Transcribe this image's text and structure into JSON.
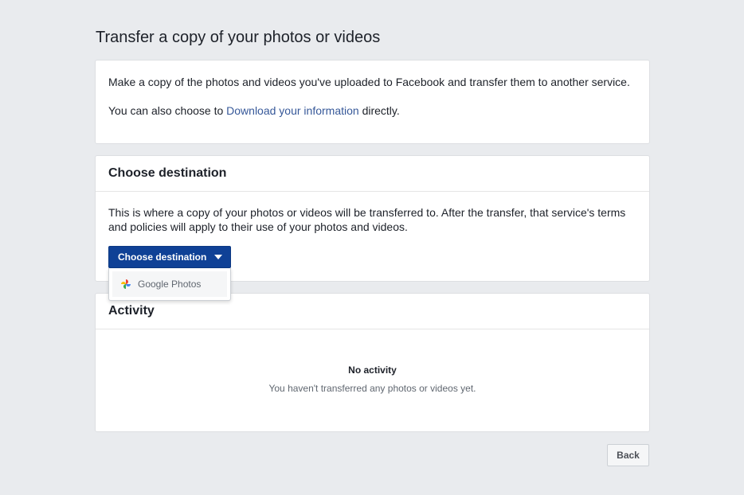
{
  "page": {
    "title": "Transfer a copy of your photos or videos"
  },
  "intro": {
    "line1": "Make a copy of the photos and videos you've uploaded to Facebook and transfer them to another service.",
    "line2_prefix": "You can also choose to ",
    "line2_link": "Download your information",
    "line2_suffix": " directly."
  },
  "destination": {
    "header": "Choose destination",
    "description": "This is where a copy of your photos or videos will be transferred to. After the transfer, that service's terms and policies will apply to their use of your photos and videos.",
    "button_label": "Choose destination",
    "dropdown_options": [
      {
        "label": "Google Photos",
        "icon": "google-photos-icon"
      }
    ]
  },
  "activity": {
    "header": "Activity",
    "empty_title": "No activity",
    "empty_subtitle": "You haven't transferred any photos or videos yet."
  },
  "footer": {
    "back_label": "Back"
  },
  "colors": {
    "background": "#e9ebee",
    "primary_button": "#0f4196",
    "link": "#365899"
  }
}
